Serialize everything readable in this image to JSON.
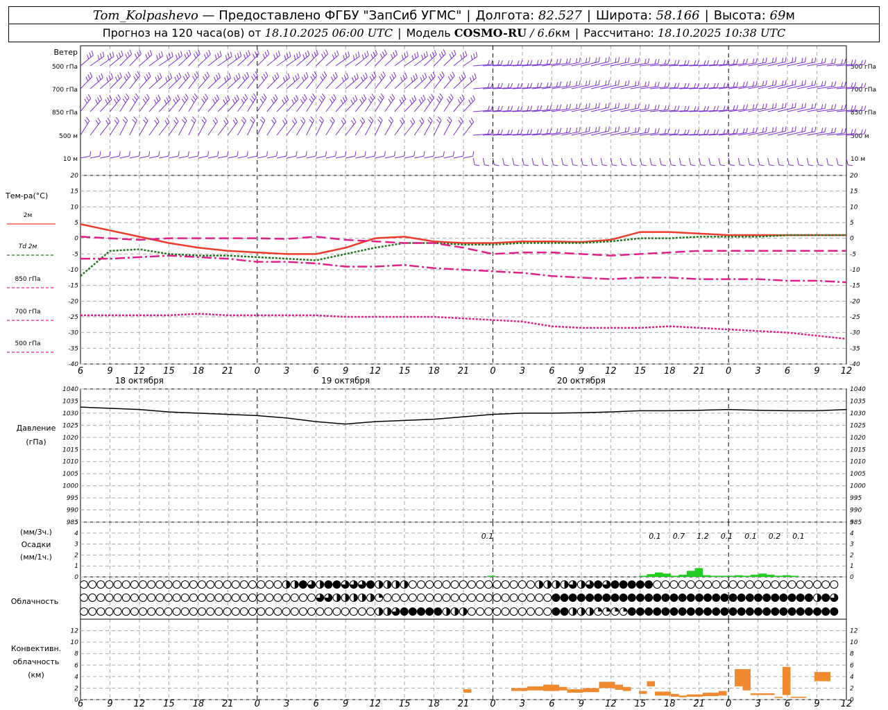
{
  "header": {
    "station": "Tom_Kolpashevo",
    "provider": "— Предоставлено ФГБУ \"ЗапСиб УГМС\"",
    "lon_label": "Долгота:",
    "lon_value": "82.527",
    "lat_label": "Широта:",
    "lat_value": "58.166",
    "alt_label": "Высота:",
    "alt_value": "69",
    "alt_unit": "м",
    "forecast_label": "Прогноз на 120 часа(ов) от",
    "forecast_time": "18.10.2025 06:00 UTC",
    "model_label": "Модель",
    "model_name": "COSMO-RU",
    "model_res": "/ 6.6",
    "model_res_unit": "км",
    "calc_label": "Рассчитано:",
    "calc_time": "18.10.2025 10:38 UTC"
  },
  "colors": {
    "wind": "#7b2fd0",
    "t2m": "#ef3b2c",
    "td2m": "#1f7a1f",
    "t850": "#e0208a",
    "t700": "#e0208a",
    "t500": "#e0208a",
    "pressure": "#000000",
    "precip": "#22cc22",
    "convective": "#f08a30",
    "grid": "#aaaaaa"
  },
  "chart_data": [
    {
      "type": "wind-barbs",
      "panel_label": "Ветер",
      "levels": [
        "500 гПа",
        "700 гПа",
        "850 гПа",
        "500 м",
        "10 м"
      ]
    },
    {
      "type": "line",
      "panel_label": "Тем-ра(°C)",
      "ylim": [
        -40,
        20
      ],
      "yticks": [
        20,
        15,
        10,
        5,
        0,
        -5,
        -10,
        -15,
        -20,
        -25,
        -30,
        -35,
        -40
      ],
      "x": [
        0,
        3,
        6,
        9,
        12,
        15,
        18,
        21,
        24,
        27,
        30,
        33,
        36,
        39,
        42,
        45,
        48,
        51,
        54,
        57,
        60,
        63,
        66,
        69,
        72,
        75,
        78
      ],
      "series": [
        {
          "name": "2м",
          "values": [
            4.5,
            2.5,
            0.5,
            -1.5,
            -3,
            -4,
            -4.5,
            -5,
            -5,
            -3,
            0,
            0.5,
            -1,
            -1.5,
            -1.5,
            -1,
            -1,
            -1.2,
            -0.5,
            2,
            2,
            1.5,
            1,
            1,
            1,
            1,
            1
          ]
        },
        {
          "name": "Td 2м",
          "values": [
            -12,
            -4,
            -3.5,
            -5,
            -5.5,
            -5.5,
            -6,
            -6.5,
            -7,
            -5,
            -3,
            -1.5,
            -1.5,
            -2,
            -2,
            -1.5,
            -1.5,
            -1.5,
            -1,
            0,
            0,
            0.5,
            0.5,
            0.5,
            1,
            1,
            1
          ]
        },
        {
          "name": "850 гПа",
          "values": [
            0.5,
            0,
            -0.5,
            0,
            0,
            0,
            0,
            -0.2,
            0.5,
            -0.5,
            -1,
            -1.5,
            -1.5,
            -3,
            -5,
            -4.5,
            -4.5,
            -5,
            -5.5,
            -5,
            -4.5,
            -4,
            -4,
            -4,
            -4,
            -4,
            -4
          ]
        },
        {
          "name": "700 гПа",
          "values": [
            -6.5,
            -6.5,
            -6,
            -5.5,
            -6,
            -6.5,
            -7.5,
            -7.5,
            -8,
            -9,
            -9,
            -8.5,
            -9.5,
            -10,
            -10.5,
            -11,
            -12,
            -12.5,
            -13,
            -12.5,
            -12.5,
            -13,
            -13,
            -13,
            -13.5,
            -13.5,
            -14
          ]
        },
        {
          "name": "500 гПа",
          "values": [
            -24.5,
            -24.5,
            -24.5,
            -24.5,
            -24,
            -24.5,
            -24.5,
            -24.5,
            -24.5,
            -25,
            -25,
            -25,
            -25,
            -25.5,
            -26,
            -26.5,
            -28,
            -28.5,
            -28.5,
            -28.5,
            -28,
            -28.5,
            -29,
            -29.5,
            -30,
            -31,
            -32
          ]
        }
      ]
    },
    {
      "type": "line",
      "panel_label": "Давление",
      "panel_unit": "(гПа)",
      "ylim": [
        985,
        1040
      ],
      "yticks": [
        1040,
        1035,
        1030,
        1025,
        1020,
        1015,
        1010,
        1005,
        1000,
        995,
        990,
        985
      ],
      "x": [
        0,
        3,
        6,
        9,
        12,
        15,
        18,
        21,
        24,
        27,
        30,
        33,
        36,
        39,
        42,
        45,
        48,
        51,
        54,
        57,
        60,
        63,
        66,
        69,
        72,
        75,
        78
      ],
      "series": [
        {
          "name": "",
          "values": [
            1032.5,
            1032,
            1031.5,
            1030.5,
            1030,
            1029.5,
            1029,
            1028,
            1026.5,
            1025.5,
            1026.5,
            1027,
            1027.5,
            1028.5,
            1029.5,
            1030,
            1030,
            1030.2,
            1030.5,
            1031,
            1031,
            1031.2,
            1031.5,
            1031.2,
            1031,
            1031,
            1031.5
          ]
        }
      ]
    },
    {
      "type": "bar",
      "panel_label": "Осадки",
      "unit_top": "(мм/3ч.)",
      "unit_bottom": "(мм/1ч.)",
      "ylim": [
        0,
        5
      ],
      "yticks": [
        5,
        4,
        3,
        2,
        1,
        0
      ],
      "hours": [
        51,
        70,
        71,
        72,
        73,
        74,
        75,
        76,
        77,
        78,
        79,
        80,
        81,
        82,
        83,
        84,
        85,
        86,
        87,
        88,
        89
      ],
      "values": [
        0.1,
        0.1,
        0.25,
        0.4,
        0.3,
        0.1,
        0.2,
        0.55,
        0.8,
        0.15,
        0.1,
        0.1,
        0.1,
        0.15,
        0.1,
        0.2,
        0.3,
        0.2,
        0.1,
        0.15,
        0.1
      ],
      "labels": [
        {
          "hour": 51,
          "text": "0.1"
        },
        {
          "hour": 72,
          "text": "0.1"
        },
        {
          "hour": 75,
          "text": "0.7"
        },
        {
          "hour": 78,
          "text": "1.2"
        },
        {
          "hour": 81,
          "text": "0.1"
        },
        {
          "hour": 84,
          "text": "0.1"
        },
        {
          "hour": 87,
          "text": "0.2"
        },
        {
          "hour": 90,
          "text": "0.1"
        }
      ]
    },
    {
      "type": "cloud-symbols",
      "panel_label": "Облачность",
      "rows": [
        "000000000000000000000000224324433342222000000000000000222232343444440000000000000000000000",
        "000000000000000000000000000033222221000000000000000000004444444444444444444444444444444243",
        "000000000000000000000000000000000002234444422200000000004422211114444444444444444444444444"
      ]
    },
    {
      "type": "bar",
      "panel_label": "Конвективн.",
      "panel_label2": "облачность",
      "panel_unit": "(км)",
      "ylim": [
        0,
        14
      ],
      "yticks": [
        12,
        10,
        8,
        6,
        4,
        2,
        0
      ],
      "cells": [
        {
          "h0": 48,
          "h1": 49,
          "b": 1.2,
          "t": 1.8
        },
        {
          "h0": 54,
          "h1": 56,
          "b": 1.5,
          "t": 2.0
        },
        {
          "h0": 56,
          "h1": 58,
          "b": 1.6,
          "t": 2.3
        },
        {
          "h0": 58,
          "h1": 60,
          "b": 1.5,
          "t": 2.6
        },
        {
          "h0": 60,
          "h1": 61,
          "b": 1.6,
          "t": 2.2
        },
        {
          "h0": 61,
          "h1": 63,
          "b": 1.2,
          "t": 1.8
        },
        {
          "h0": 63,
          "h1": 65,
          "b": 1.3,
          "t": 2.0
        },
        {
          "h0": 65,
          "h1": 67,
          "b": 2.0,
          "t": 3.1
        },
        {
          "h0": 67,
          "h1": 68,
          "b": 1.7,
          "t": 2.6
        },
        {
          "h0": 68,
          "h1": 69,
          "b": 1.5,
          "t": 2.2
        },
        {
          "h0": 70,
          "h1": 71,
          "b": 1.0,
          "t": 1.5
        },
        {
          "h0": 71,
          "h1": 72,
          "b": 2.3,
          "t": 3.2
        },
        {
          "h0": 72,
          "h1": 74,
          "b": 0.7,
          "t": 1.4
        },
        {
          "h0": 74,
          "h1": 75,
          "b": 0.5,
          "t": 1.0
        },
        {
          "h0": 75,
          "h1": 76,
          "b": 0.4,
          "t": 0.7
        },
        {
          "h0": 76,
          "h1": 78,
          "b": 0.5,
          "t": 0.9
        },
        {
          "h0": 78,
          "h1": 80,
          "b": 0.6,
          "t": 1.2
        },
        {
          "h0": 80,
          "h1": 81,
          "b": 0.7,
          "t": 1.5
        },
        {
          "h0": 82,
          "h1": 83,
          "b": 2.3,
          "t": 5.3
        },
        {
          "h0": 83,
          "h1": 84,
          "b": 1.6,
          "t": 5.3
        },
        {
          "h0": 84,
          "h1": 87,
          "b": 0.8,
          "t": 1.1
        },
        {
          "h0": 87,
          "h1": 88,
          "b": 0.3,
          "t": 0.5
        },
        {
          "h0": 88,
          "h1": 89,
          "b": 0.8,
          "t": 5.7
        },
        {
          "h0": 89,
          "h1": 91,
          "b": 0.3,
          "t": 0.5
        },
        {
          "h0": 92,
          "h1": 94,
          "b": 3.2,
          "t": 4.8
        }
      ]
    }
  ],
  "time_axis": {
    "hours_per_step": 3,
    "tick_labels": [
      "6",
      "9",
      "12",
      "15",
      "18",
      "21",
      "0",
      "3",
      "6",
      "9",
      "12",
      "15",
      "18",
      "21",
      "0",
      "3",
      "6",
      "9",
      "12",
      "15",
      "18",
      "21",
      "0",
      "3",
      "6",
      "9",
      "12"
    ],
    "day_labels": [
      "18 октября",
      "19 октября",
      "20 октября"
    ]
  }
}
